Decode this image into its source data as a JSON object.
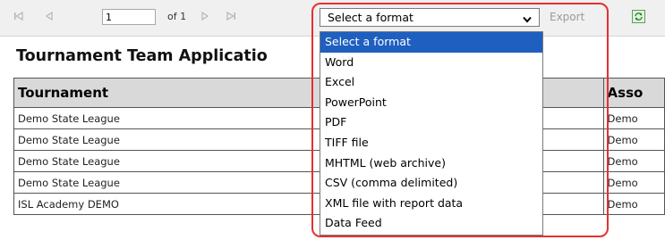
{
  "toolbar": {
    "page_value": "1",
    "of_text": "of 1",
    "format_selected": "Select a format",
    "export_label": "Export",
    "nav_icons": [
      "first-page-icon",
      "previous-page-icon",
      "next-page-icon",
      "last-page-icon"
    ]
  },
  "report": {
    "title": "Tournament Team Applicatio",
    "headers": [
      "Tournament",
      "",
      "Asso"
    ],
    "rows": [
      [
        "Demo State League",
        "",
        "Demo"
      ],
      [
        "Demo State League",
        "",
        "Demo"
      ],
      [
        "Demo State League",
        "",
        "Demo"
      ],
      [
        "Demo State League",
        "",
        "Demo"
      ],
      [
        "ISL Academy DEMO",
        "",
        "Demo"
      ]
    ]
  },
  "format_dropdown": {
    "options": [
      "Select a format",
      "Word",
      "Excel",
      "PowerPoint",
      "PDF",
      "TIFF file",
      "MHTML (web archive)",
      "CSV (comma delimited)",
      "XML file with report data",
      "Data Feed"
    ],
    "selected_index": 0
  },
  "colors": {
    "highlight": "#e53030",
    "selected_option_bg": "#1f5fbf",
    "toolbar_bg": "#f0f0f0",
    "header_bg": "#d9d9d9"
  }
}
